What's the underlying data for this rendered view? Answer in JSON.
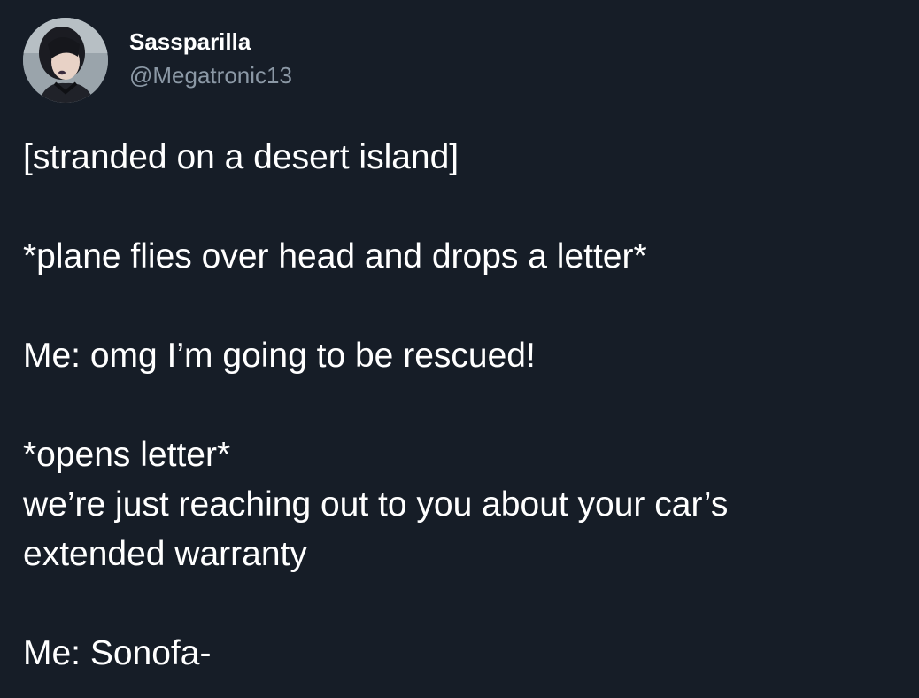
{
  "user": {
    "display_name": "Sassparilla",
    "handle": "@Megatronic13"
  },
  "tweet": {
    "lines": [
      "[stranded on a desert island]",
      "",
      "*plane flies over head and drops a letter*",
      "",
      "Me: omg I’m going to be rescued!",
      "",
      "*opens letter*",
      "we’re just reaching out to you about your car’s",
      "extended warranty",
      "",
      "Me: Sonofa-"
    ]
  },
  "colors": {
    "background": "#161d27",
    "text": "#ffffff",
    "secondary_text": "#8b98a5"
  },
  "icons": {
    "avatar": "profile-photo"
  }
}
